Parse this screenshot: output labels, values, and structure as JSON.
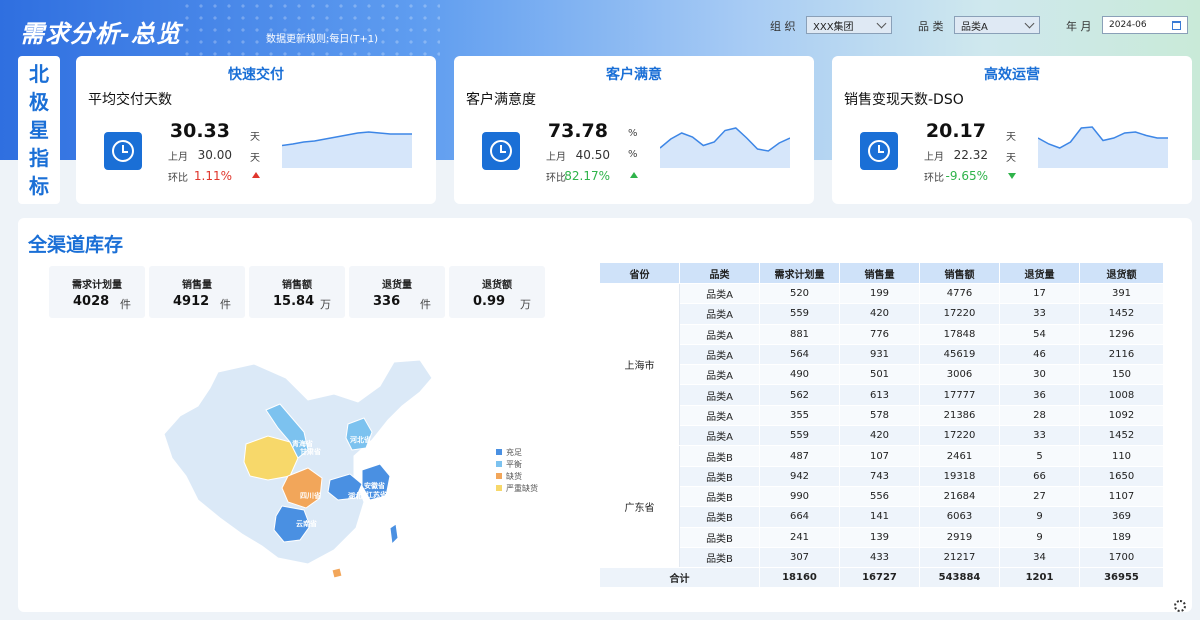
{
  "header": {
    "title": "需求分析-总览",
    "update_rule": "数据更新规则:每日(T+1)",
    "filters": {
      "org_label": "组 织",
      "org_value": "XXX集团",
      "category_label": "品 类",
      "category_value": "品类A",
      "month_label": "年 月",
      "month_value": "2024-06"
    }
  },
  "north_star": [
    "北",
    "极",
    "星",
    "指",
    "标"
  ],
  "kpis": [
    {
      "section": "快速交付",
      "name": "平均交付天数",
      "value": "30.33",
      "unit": "天",
      "prev_label": "上月",
      "prev_value": "30.00",
      "prev_unit": "天",
      "mom_label": "环比",
      "mom_value": "1.11%",
      "trend": "up",
      "trend_color": "#e0362c",
      "spark": [
        0.55,
        0.52,
        0.48,
        0.46,
        0.42,
        0.38,
        0.34,
        0.3,
        0.28,
        0.3,
        0.32,
        0.32,
        0.32
      ]
    },
    {
      "section": "客户满意",
      "name": "客户满意度",
      "value": "73.78",
      "unit": "%",
      "prev_label": "上月",
      "prev_value": "40.50",
      "prev_unit": "%",
      "mom_label": "环比",
      "mom_value": "82.17%",
      "trend": "up",
      "trend_color": "#2fb34a",
      "spark": [
        0.6,
        0.42,
        0.3,
        0.38,
        0.55,
        0.48,
        0.25,
        0.2,
        0.4,
        0.62,
        0.66,
        0.5,
        0.4
      ]
    },
    {
      "section": "高效运营",
      "name": "销售变现天数-DSO",
      "value": "20.17",
      "unit": "天",
      "prev_label": "上月",
      "prev_value": "22.32",
      "prev_unit": "天",
      "mom_label": "环比",
      "mom_value": "-9.65%",
      "trend": "down",
      "trend_color": "#2fb34a",
      "spark": [
        0.4,
        0.52,
        0.6,
        0.48,
        0.2,
        0.18,
        0.45,
        0.4,
        0.3,
        0.28,
        0.35,
        0.4,
        0.4
      ]
    }
  ],
  "inventory": {
    "title": "全渠道库存",
    "stats": [
      {
        "label": "需求计划量",
        "value": "4028",
        "unit": "件"
      },
      {
        "label": "销售量",
        "value": "4912",
        "unit": "件"
      },
      {
        "label": "销售额",
        "value": "15.84",
        "unit": "万"
      },
      {
        "label": "退货量",
        "value": "336",
        "unit": "件"
      },
      {
        "label": "退货额",
        "value": "0.99",
        "unit": "万"
      }
    ],
    "map_labels": [
      "青海省",
      "甘肃省",
      "河北省",
      "四川省",
      "湖北省",
      "安徽省",
      "江苏省",
      "云南省"
    ],
    "legend": [
      {
        "label": "充足",
        "color": "#4a90e2"
      },
      {
        "label": "平衡",
        "color": "#7cc2ef"
      },
      {
        "label": "缺货",
        "color": "#f2a65a"
      },
      {
        "label": "严重缺货",
        "color": "#f7d86a"
      }
    ],
    "table": {
      "headers": [
        "省份",
        "品类",
        "需求计划量",
        "销售量",
        "销售额",
        "退货量",
        "退货额"
      ],
      "groups": [
        {
          "province": "上海市",
          "rows": [
            [
              "品类A",
              "520",
              "199",
              "4776",
              "17",
              "391"
            ],
            [
              "品类A",
              "559",
              "420",
              "17220",
              "33",
              "1452"
            ],
            [
              "品类A",
              "881",
              "776",
              "17848",
              "54",
              "1296"
            ],
            [
              "品类A",
              "564",
              "931",
              "45619",
              "46",
              "2116"
            ],
            [
              "品类A",
              "490",
              "501",
              "3006",
              "30",
              "150"
            ],
            [
              "品类A",
              "562",
              "613",
              "17777",
              "36",
              "1008"
            ],
            [
              "品类A",
              "355",
              "578",
              "21386",
              "28",
              "1092"
            ],
            [
              "品类A",
              "559",
              "420",
              "17220",
              "33",
              "1452"
            ]
          ]
        },
        {
          "province": "广东省",
          "rows": [
            [
              "品类B",
              "487",
              "107",
              "2461",
              "5",
              "110"
            ],
            [
              "品类B",
              "942",
              "743",
              "19318",
              "66",
              "1650"
            ],
            [
              "品类B",
              "990",
              "556",
              "21684",
              "27",
              "1107"
            ],
            [
              "品类B",
              "664",
              "141",
              "6063",
              "9",
              "369"
            ],
            [
              "品类B",
              "241",
              "139",
              "2919",
              "9",
              "189"
            ],
            [
              "品类B",
              "307",
              "433",
              "21217",
              "34",
              "1700"
            ]
          ]
        }
      ],
      "total": {
        "label": "合计",
        "values": [
          "18160",
          "16727",
          "543884",
          "1201",
          "36955"
        ]
      }
    }
  }
}
